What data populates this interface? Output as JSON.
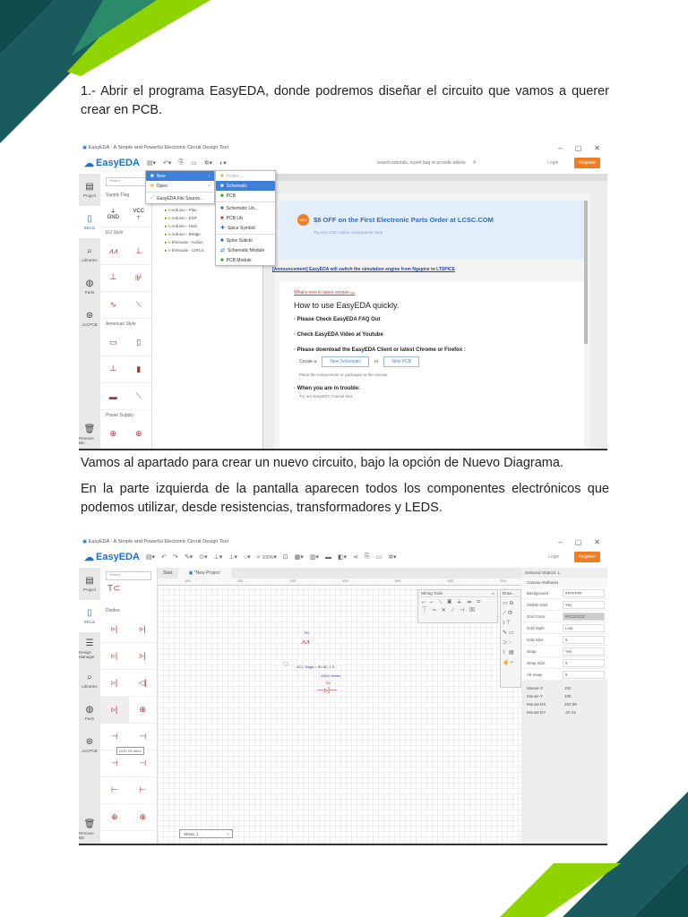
{
  "doc": {
    "p1": "1.- Abrir el programa EasyEDA, donde podremos diseñar el circuito que vamos a querer crear en PCB.",
    "p2": "Vamos al apartado para crear un nuevo circuito, bajo la opción de Nuevo Diagrama.",
    "p3": "En la parte izquierda de la pantalla aparecen todos los componentes electrónicos que podemos utilizar, desde resistencias, transformadores y LEDS."
  },
  "colors": {
    "teal": "#1a5c5e",
    "green": "#8fd400",
    "accent": "#f47c20",
    "link": "#1d6fcc"
  },
  "shot1": {
    "window_title": "EasyEDA - A Simple and Powerful Electronic Circuit Design Tool",
    "logo": "EasyEDA",
    "search_placeholder": "search tutorials, report bug or provide advice",
    "login": "Login",
    "register": "Register",
    "nav": [
      "Project",
      "EELib",
      "Libraries",
      "Parts",
      "JLCPCB",
      "Remove Bin"
    ],
    "lib_search": "Search",
    "lib_sections": [
      "Supply Flag",
      "EU Style",
      "American Style",
      "Power Supply"
    ],
    "gnd": "GND",
    "vcc": "VCC",
    "file_menu": [
      "New",
      "Open",
      "EasyEDA File Source..."
    ],
    "new_menu": [
      "Folder...",
      "Schematic",
      "PCB",
      "Schematic Lib...",
      "PCB Lib",
      "Spice Symbol",
      "Spice Subckt",
      "Schematic Module",
      "PCB Module"
    ],
    "tree": [
      "Arduino - Plan",
      "Arduino - ESP",
      "Arduino - Helic",
      "Arduino - Bridge",
      "ElVisuals - Arduin",
      "ElVisuals - CIRCA"
    ],
    "promo_badge": "NEW",
    "promo_title": "$8 OFF on the First Electronic Parts Order at LCSC.COM",
    "promo_sub": "Try out LCSC online components store",
    "announcement": "[Announcement] EasyEDA will switch the simulation engine from Ngspice to LTSPICE",
    "whats_new": "What's new in latest version",
    "howto_title": "How to use EasyEDA quickly.",
    "bullets": [
      "Please Check EasyEDA FAQ Out",
      "Check EasyEDA Video at Youtube",
      "Please download the EasyEDA Client or latest Chrome or Firefox :"
    ],
    "create": "Create a",
    "new_schematic": "New Schematic",
    "or": "or",
    "new_pcb": "New PCB",
    "place_hint": "Place the components or packages to the canvas.",
    "trouble": "When you are in trouble:",
    "tutorial": "Try our EasyEDA Tutorial Out."
  },
  "shot2": {
    "window_title": "EasyEDA - A Simple and Powerful Electronic Circuit Design Tool",
    "logo": "EasyEDA",
    "zoom": "100%",
    "login": "Login",
    "register": "Register",
    "nav": [
      "Project",
      "EELib",
      "Design Manager",
      "Libraries",
      "Parts",
      "JLCPCB",
      "Remove Bin"
    ],
    "lib_search": "Search",
    "lib_section": "Diodes",
    "tooltip": "LED-TH-3mm",
    "tabs": [
      "Start",
      "*New Project"
    ],
    "ruler": [
      "100",
      "200",
      "300",
      "400",
      "500",
      "600",
      "700"
    ],
    "wiring_tools": "Wiring Tools",
    "drawing_tools": "Draw...",
    "circuit_labels": [
      "R1",
      "AC1 Stage = 5V AC 1 5",
      "LED1 Green",
      "D1"
    ],
    "sheet_tab": "Sheet_1",
    "props_header": "Selected Objects: 1",
    "canvas_attrs": "Canvas Attributes",
    "props": [
      {
        "k": "Background",
        "v": "#FFFFFF"
      },
      {
        "k": "Visible Grid",
        "v": "Yes"
      },
      {
        "k": "Grid Color",
        "v": "#CCCCCC"
      },
      {
        "k": "Grid Style",
        "v": "Line"
      },
      {
        "k": "Grid Size",
        "v": "5"
      },
      {
        "k": "Snap",
        "v": "Yes"
      },
      {
        "k": "Snap Size",
        "v": "5"
      },
      {
        "k": "Alt Snap",
        "v": "5"
      }
    ],
    "mouse": [
      {
        "k": "Mouse-X",
        "v": "150"
      },
      {
        "k": "Mouse-Y",
        "v": "105"
      },
      {
        "k": "Mouse-DX",
        "v": "284.99"
      },
      {
        "k": "Mouse-DY",
        "v": "-20.44"
      }
    ]
  }
}
